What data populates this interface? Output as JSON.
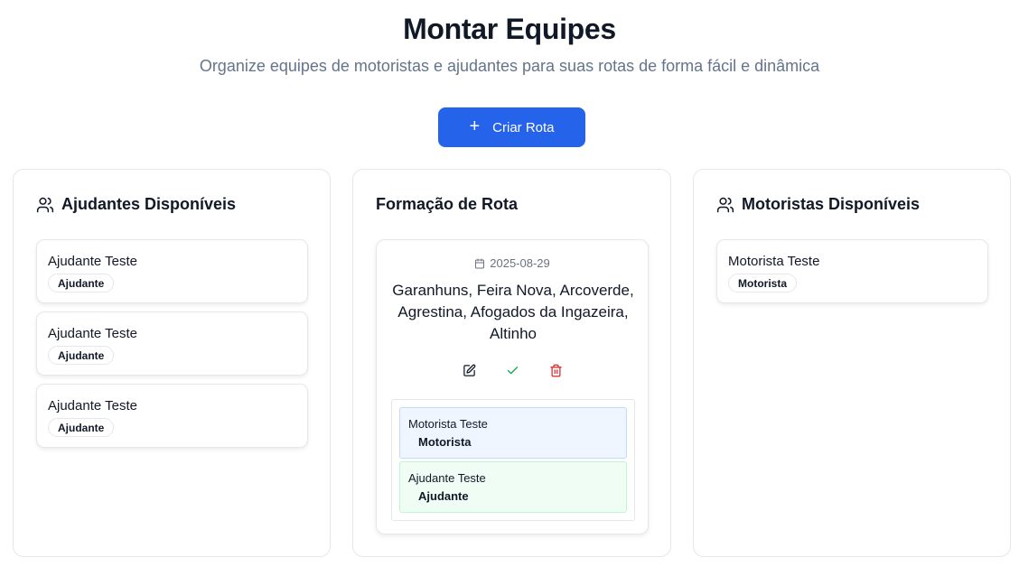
{
  "header": {
    "title": "Montar Equipes",
    "subtitle": "Organize equipes de motoristas e ajudantes para suas rotas de forma fácil e dinâmica"
  },
  "create_button": {
    "label": "Criar Rota",
    "icon": "plus-icon"
  },
  "colors": {
    "primary": "#2563eb",
    "driver_bg": "#eff6ff",
    "helper_bg": "#f0fdf4",
    "delete": "#dc2626",
    "confirm": "#16a34a"
  },
  "helpers_column": {
    "title": "Ajudantes Disponíveis",
    "icon": "users-icon",
    "items": [
      {
        "name": "Ajudante Teste",
        "role": "Ajudante"
      },
      {
        "name": "Ajudante Teste",
        "role": "Ajudante"
      },
      {
        "name": "Ajudante Teste",
        "role": "Ajudante"
      }
    ]
  },
  "route_column": {
    "title": "Formação de Rota",
    "route": {
      "date": "2025-08-29",
      "cities": "Garanhuns, Feira Nova, Arcoverde, Agrestina, Afogados da Ingazeira, Altinho",
      "actions": [
        "edit-icon",
        "check-icon",
        "trash-icon"
      ],
      "team": [
        {
          "name": "Motorista Teste",
          "role": "Motorista"
        },
        {
          "name": "Ajudante Teste",
          "role": "Ajudante"
        }
      ]
    }
  },
  "drivers_column": {
    "title": "Motoristas Disponíveis",
    "icon": "users-icon",
    "items": [
      {
        "name": "Motorista Teste",
        "role": "Motorista"
      }
    ]
  }
}
